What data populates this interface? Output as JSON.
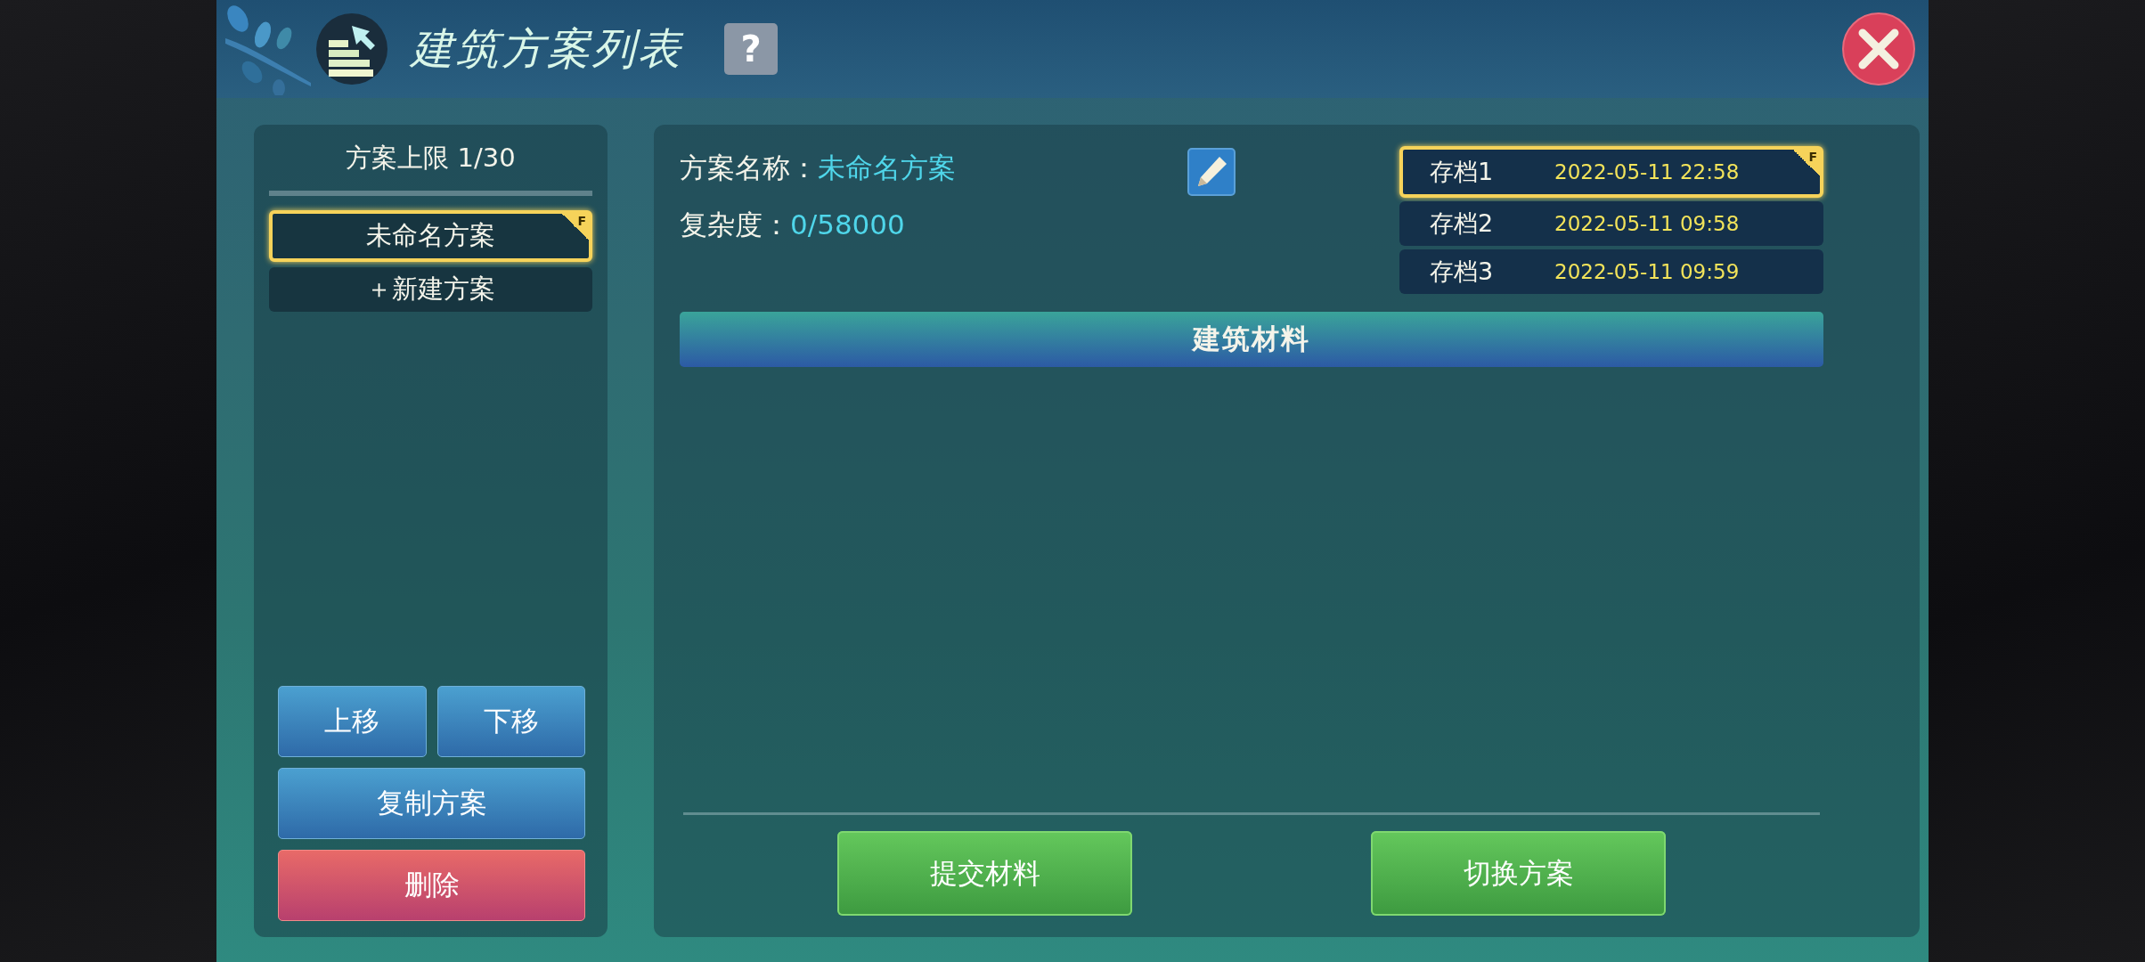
{
  "window": {
    "title": "建筑方案列表",
    "help": "?"
  },
  "plan_list": {
    "limit": "方案上限 1/30",
    "items": [
      {
        "label": "未命名方案",
        "selected": true,
        "badge": "F"
      }
    ],
    "new_plan": "＋新建方案",
    "actions": [
      {
        "label": "上移",
        "kind": "move"
      },
      {
        "label": "下移",
        "kind": "move"
      },
      {
        "label": "复制方案",
        "kind": "copy"
      },
      {
        "label": "删除",
        "kind": "delete"
      }
    ]
  },
  "details": {
    "name_label": "方案名称：",
    "name_value": "未命名方案",
    "complexity_label": "复杂度：",
    "complexity_value": "0/58000",
    "saves": [
      {
        "label": "存档1",
        "time": "2022-05-11 22:58",
        "selected": true,
        "badge": "F"
      },
      {
        "label": "存档2",
        "time": "2022-05-11 09:58",
        "selected": false
      },
      {
        "label": "存档3",
        "time": "2022-05-11 09:59",
        "selected": false
      }
    ],
    "materials_header": "建筑材料",
    "buttons": [
      "提交材料",
      "切换方案"
    ]
  }
}
